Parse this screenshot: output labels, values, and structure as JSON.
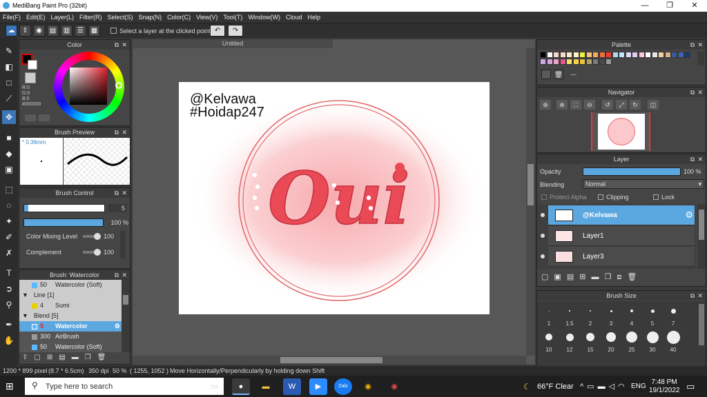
{
  "window": {
    "title": "MediBang Paint Pro (32bit)",
    "min": "—",
    "max": "❐",
    "close": "✕"
  },
  "menu": [
    "File(F)",
    "Edit(E)",
    "Layer(L)",
    "Filter(R)",
    "Select(S)",
    "Snap(N)",
    "Color(C)",
    "View(V)",
    "Tool(T)",
    "Window(W)",
    "Cloud",
    "Help"
  ],
  "toolbar": {
    "select_layer_label": "Select a layer at the clicked point"
  },
  "color_panel": {
    "title": "Color",
    "r": "R:0",
    "g": "G:0",
    "b": "B:0",
    "hex": "#000000"
  },
  "brush_preview": {
    "title": "Brush Preview",
    "size": "0.36mm"
  },
  "brush_control": {
    "title": "Brush Control",
    "size_value": "5",
    "opacity_value": "100 %",
    "mixing_label": "Color Mixing Level",
    "mixing_value": "100",
    "complement_label": "Complement",
    "complement_value": "100"
  },
  "brush_list": {
    "title": "Brush: Watercolor",
    "items": [
      {
        "type": "item",
        "size": "50",
        "name": "Watercolor (Soft)",
        "color": "#5ab8ff"
      },
      {
        "type": "group",
        "name": "Line [1]"
      },
      {
        "type": "item",
        "size": "4",
        "name": "Sumi",
        "color": "#e8d000"
      },
      {
        "type": "group",
        "name": "Blend [5]"
      },
      {
        "type": "item",
        "size": "5",
        "name": "Watercolor",
        "color": "#5ab8ff",
        "selected": true
      },
      {
        "type": "item",
        "size": "300",
        "name": "AirBrush",
        "color": "#9a9a9a"
      },
      {
        "type": "item",
        "size": "50",
        "name": "Watercolor (Soft)",
        "color": "#5ab8ff"
      }
    ]
  },
  "document": {
    "tab_title": "Untitled",
    "text_line1": "@Kelvawa",
    "text_line2": "#Hoidap247",
    "art_text": "Oui"
  },
  "palette": {
    "title": "Palette",
    "name_placeholder": "---",
    "colors": [
      "#000000",
      "#ffffff",
      "#f6d5cf",
      "#f9dcc8",
      "#fbe8c8",
      "#fdf2c6",
      "#f1f23a",
      "#fbbf7c",
      "#f7a95a",
      "#f36d3a",
      "#ef3b2c",
      "#b6d7f2",
      "#bfe6f9",
      "#dcdcf5",
      "#e8c9f0",
      "#f5c8dc",
      "#ffffff",
      "#e8e8e8",
      "#f3d0a0",
      "#d6b38a",
      "#3c5a9a",
      "#3a66b6",
      "#1b3a70",
      "#c9a9e8",
      "#d7a3d8",
      "#f2a2c8",
      "#e35a8a",
      "#f9e066",
      "#f5d04a",
      "#ecc23c",
      "#b1a06a",
      "#7a7a7a",
      "#4a4a4a",
      "#999999"
    ]
  },
  "navigator": {
    "title": "Navigator"
  },
  "layer_panel": {
    "title": "Layer",
    "opacity_label": "Opacity",
    "opacity_value": "100 %",
    "opacity_fraction": 1.0,
    "blending_label": "Blending",
    "blending_value": "Normal",
    "protect_alpha": "Protect Alpha",
    "clipping": "Clipping",
    "lock": "Lock",
    "layers": [
      {
        "name": "@Kelvawa",
        "selected": true
      },
      {
        "name": "Layer1"
      },
      {
        "name": "Layer3"
      }
    ]
  },
  "brush_size_panel": {
    "title": "Brush Size",
    "sizes": [
      "1",
      "1.5",
      "2",
      "3",
      "4",
      "5",
      "7",
      "10",
      "12",
      "15",
      "20",
      "25",
      "30",
      "40"
    ]
  },
  "status": {
    "dimensions": "1200 * 899 pixel",
    "physical": "(8.7 * 6.5cm)",
    "dpi": "350 dpi",
    "zoom": "50 %",
    "coords": "( 1255, 1052 )",
    "hint": "Move Horizontally/Perpendicularly by holding down Shift"
  },
  "taskbar": {
    "search_placeholder": "Type here to search",
    "weather": "66°F  Clear",
    "lang": "ENG",
    "time": "7:48 PM",
    "date": "19/1/2022"
  }
}
